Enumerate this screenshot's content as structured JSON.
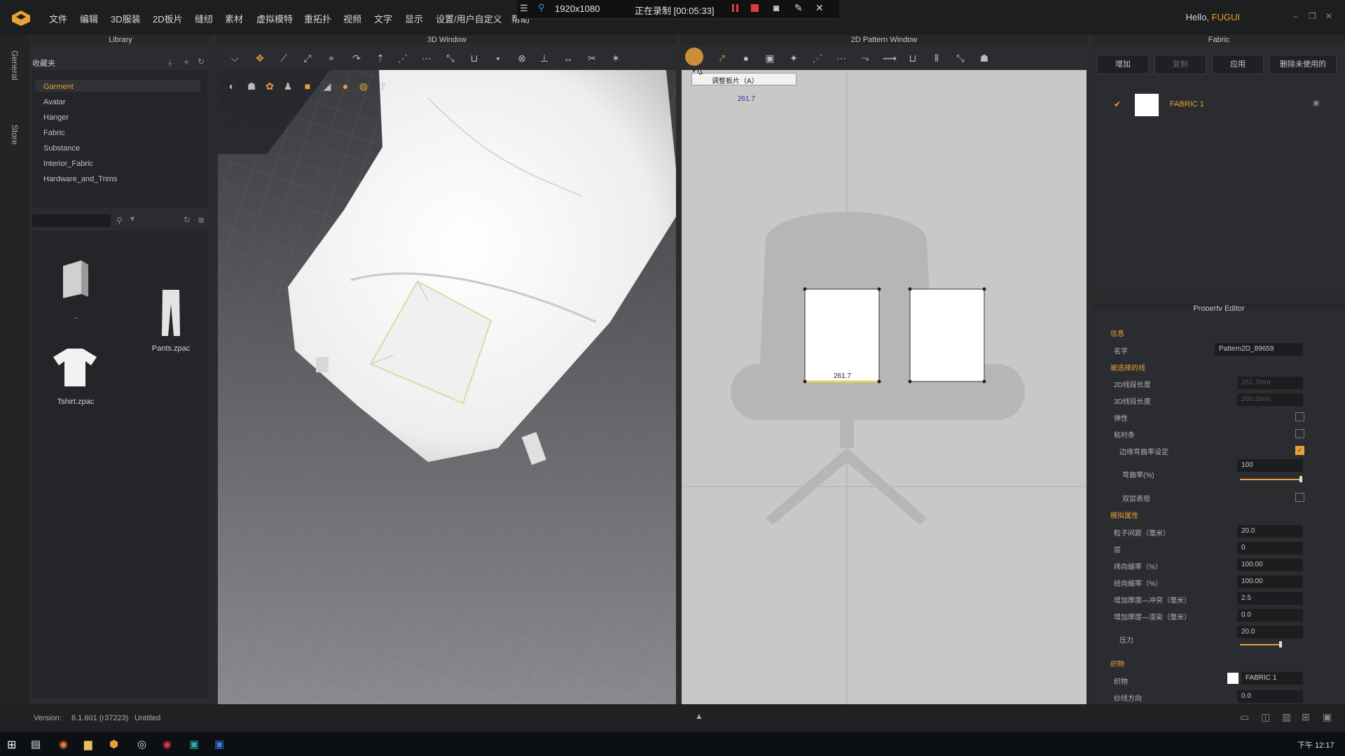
{
  "menubar": {
    "items": [
      "文件",
      "编辑",
      "3D服装",
      "2D板片",
      "缝纫",
      "素材",
      "虚拟模特",
      "重拓扑",
      "视频",
      "文字",
      "显示",
      "设置/用户自定义",
      "帮助"
    ],
    "greeting": "Hello,",
    "user": "FUGUI"
  },
  "recording": {
    "resolution": "1920x1080",
    "status": "正在录制 [00:05:33]"
  },
  "side_tabs": [
    "General",
    "Store"
  ],
  "library": {
    "title": "Library",
    "favorites_label": "收藏夹",
    "folders": [
      "Garment",
      "Avatar",
      "Hanger",
      "Fabric",
      "Substance",
      "Interior_Fabric",
      "Hardware_and_Trims"
    ],
    "files": [
      {
        "name": "..",
        "icon": "back-folder-icon"
      },
      {
        "name": "Pants.zpac",
        "icon": "pants-icon"
      },
      {
        "name": "Tshirt.zpac",
        "icon": "tshirt-icon"
      }
    ]
  },
  "window3d": {
    "title": "3D Window"
  },
  "window2d": {
    "title": "2D Pattern Window",
    "tooltip": "调整板片（A）",
    "measure_top": "261.7",
    "measure_pattern": "261.7"
  },
  "fabric": {
    "title": "Fabric",
    "buttons": [
      "增加",
      "复制",
      "应用",
      "删除未使用的"
    ],
    "item_name": "FABRIC 1"
  },
  "property_editor": {
    "title": "Property Editor",
    "sections": {
      "info": "信息",
      "selected_line": "被选择的线",
      "sim": "模拟属性",
      "fabric": "织物"
    },
    "rows": {
      "name_label": "名字",
      "name_value": "Pattern2D_89659",
      "len2d_label": "2D线段长度",
      "len2d_value": "261.7mm",
      "len3d_label": "3D线段长度",
      "len3d_value": "260.2mm",
      "elastic_label": "弹性",
      "fusible_label": "粘衬条",
      "curvature_label": "边缘弯曲率设定",
      "curvature_pct_label": "弯曲率(%)",
      "curvature_pct_value": "100",
      "double_label": "双层表现",
      "particle_label": "粒子间距（毫米）",
      "particle_value": "20.0",
      "layer_label": "层",
      "layer_value": "0",
      "warp_label": "纬向缩率（%）",
      "warp_value": "100.00",
      "weft_label": "经向缩率（%）",
      "weft_value": "100.00",
      "thick_collision_label": "增加厚度—冲突（毫米）",
      "thick_collision_value": "2.5",
      "thick_render_label": "增加厚度—渲染（毫米）",
      "thick_render_value": "0.0",
      "pressure_label": "压力",
      "pressure_value": "20.0",
      "fabric_label": "织物",
      "fabric_value": "FABRIC 1",
      "grain_label": "纱线方向",
      "grain_value": "0.0"
    }
  },
  "statusbar": {
    "version_label": "Version:",
    "version": "6.1.601 (r37223)",
    "file": "Untitled"
  },
  "taskbar": {
    "clock": "下午 12:17"
  },
  "colors": {
    "accent": "#e8a13a",
    "bg": "#2b2c2f",
    "pattern_bg": "#c8c8c8"
  }
}
